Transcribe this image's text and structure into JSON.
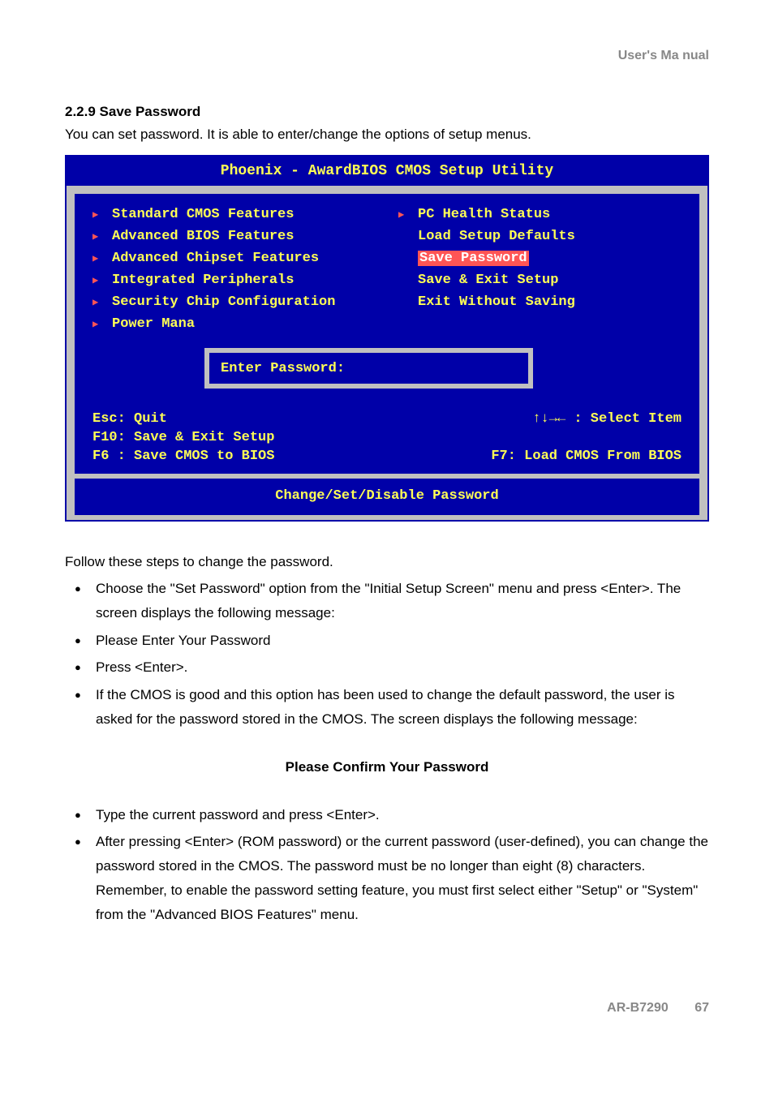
{
  "header": "User's Ma nual",
  "section": {
    "heading": "2.2.9 Save    Password",
    "intro": "You can set password. It is able to enter/change the options of setup menus."
  },
  "bios": {
    "title": "Phoenix - AwardBIOS CMOS Setup Utility",
    "left_items": [
      {
        "label": "Standard CMOS Features",
        "arrow": true
      },
      {
        "label": "Advanced BIOS Features",
        "arrow": true
      },
      {
        "label": "Advanced Chipset Features",
        "arrow": true
      },
      {
        "label": "Integrated Peripherals",
        "arrow": true
      },
      {
        "label": "Security Chip Configuration",
        "arrow": true
      },
      {
        "label": "Power Mana",
        "arrow": true
      }
    ],
    "right_items": [
      {
        "label": "PC Health Status",
        "arrow": true
      },
      {
        "label": "Load Setup Defaults",
        "arrow": false
      },
      {
        "label": "Save Password",
        "arrow": false,
        "selected": true
      },
      {
        "label": "Save & Exit Setup",
        "arrow": false
      },
      {
        "label": "Exit Without Saving",
        "arrow": false
      }
    ],
    "password_prompt": "Enter Password:",
    "keys": {
      "esc": "Esc: Quit",
      "arrows": "↑↓→← : Select Item",
      "f10": "F10: Save & Exit Setup",
      "f6": "F6 : Save CMOS to BIOS",
      "f7": "F7: Load CMOS From BIOS"
    },
    "footer": "Change/Set/Disable Password"
  },
  "follow_text": "Follow these steps to change the password.",
  "bullets1": [
    "Choose the \"Set Password\" option from the \"Initial Setup Screen\" menu and press <Enter>. The screen displays the following message:",
    "Please Enter Your Password",
    "Press <Enter>.",
    "If the CMOS is good and this option has been used to change the default password, the user is asked for the password stored in the CMOS. The screen displays the following message:"
  ],
  "confirm_heading": "Please Confirm Your Password",
  "bullets2": [
    "Type the current password and press <Enter>.",
    "After pressing <Enter> (ROM password) or the current password (user-defined), you can change the password stored in the CMOS. The password must be no longer than eight (8) characters. Remember, to enable the password setting feature, you must first select either \"Setup\" or \"System\" from the \"Advanced BIOS Features\" menu."
  ],
  "footer": {
    "model": "AR-B7290",
    "page": "67"
  }
}
